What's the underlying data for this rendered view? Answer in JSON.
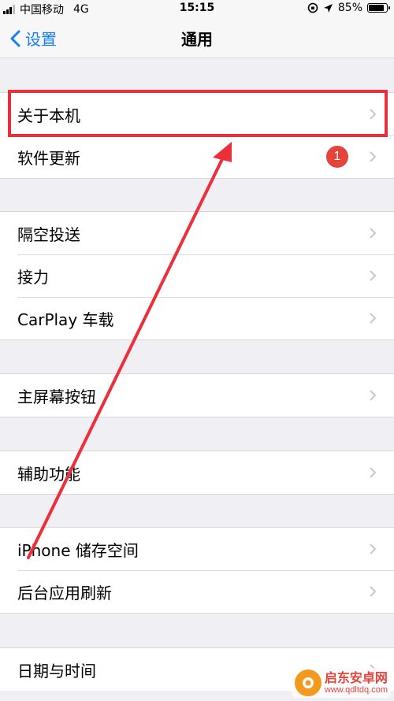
{
  "status_bar": {
    "carrier": "中国移动",
    "network": "4G",
    "time": "15:15",
    "battery_percent": "85%",
    "battery_level": 0.85
  },
  "nav": {
    "back_label": "设置",
    "title": "通用"
  },
  "groups": [
    {
      "items": [
        {
          "label": "关于本机"
        },
        {
          "label": "软件更新",
          "badge": "1"
        }
      ]
    },
    {
      "items": [
        {
          "label": "隔空投送"
        },
        {
          "label": "接力"
        },
        {
          "label": "CarPlay 车载"
        }
      ]
    },
    {
      "items": [
        {
          "label": "主屏幕按钮"
        }
      ]
    },
    {
      "items": [
        {
          "label": "辅助功能"
        }
      ]
    },
    {
      "items": [
        {
          "label": "iPhone 储存空间"
        },
        {
          "label": "后台应用刷新"
        }
      ]
    },
    {
      "items": [
        {
          "label": "日期与时间"
        }
      ]
    }
  ],
  "watermark": {
    "name": "启东安卓网",
    "url": "www.qdltdq.com"
  },
  "colors": {
    "accent": "#147efb",
    "badge": "#e5443a",
    "annotation": "#ec2f3a"
  }
}
